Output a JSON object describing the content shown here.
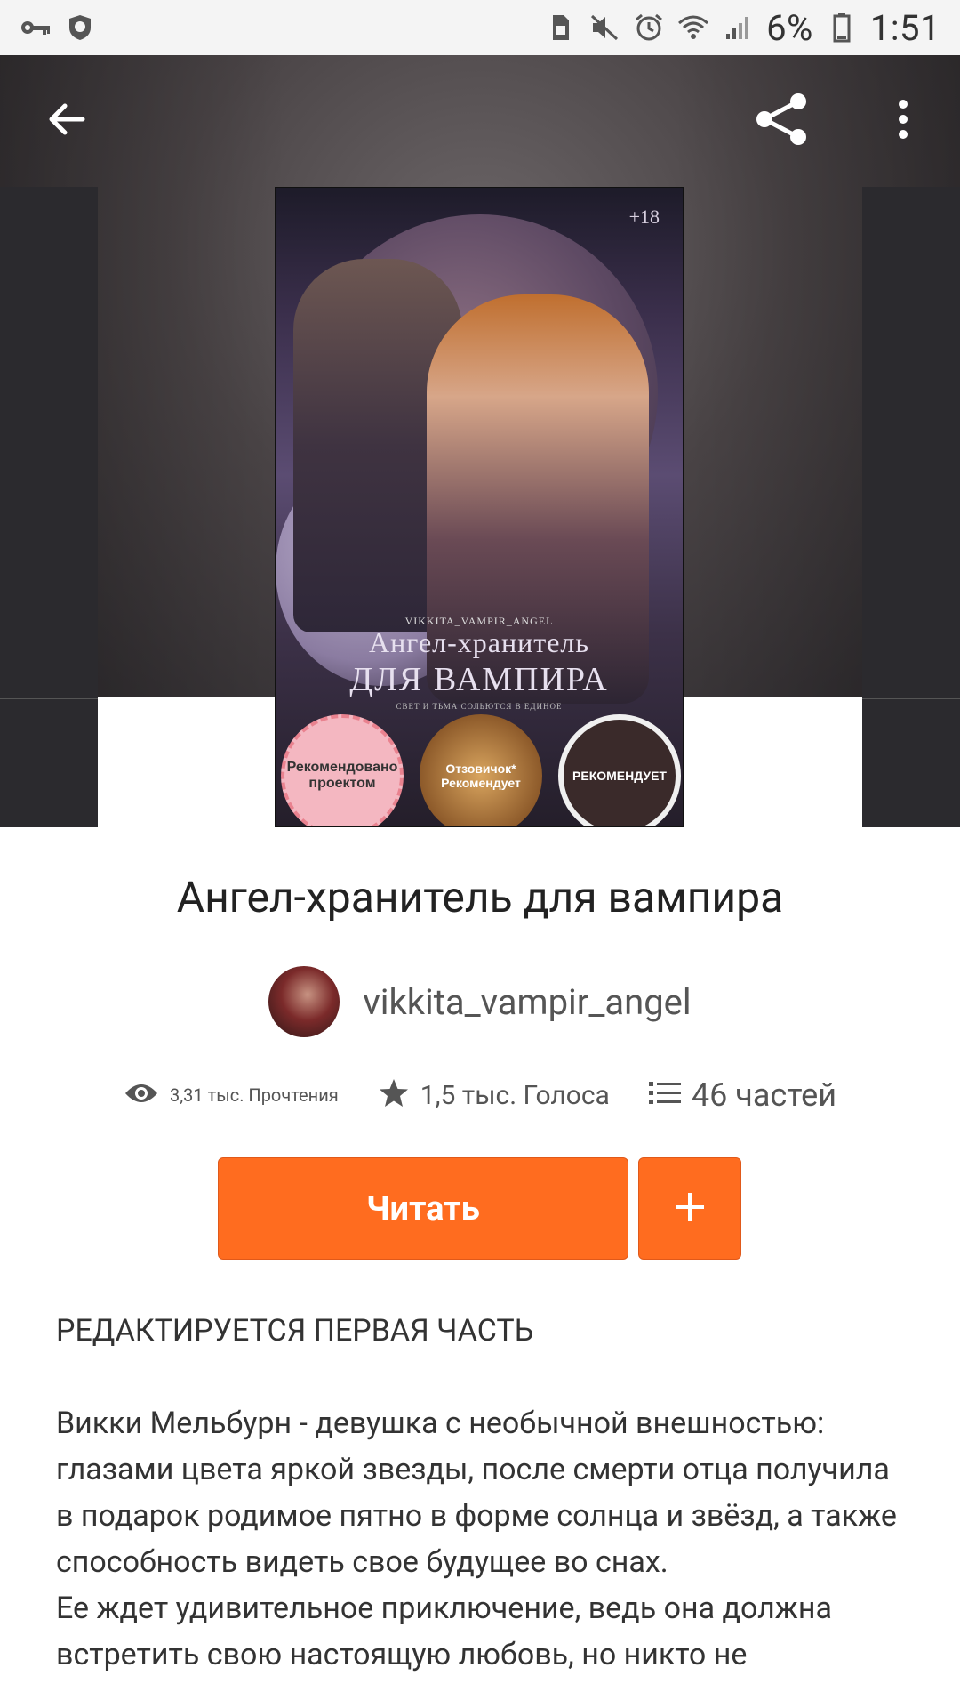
{
  "status_bar": {
    "left_icons": [
      "key-icon",
      "shield-icon"
    ],
    "right_icons": [
      "sim-icon",
      "mute-icon",
      "alarm-icon",
      "wifi-icon",
      "signal-icon",
      "battery-icon"
    ],
    "battery": "6%",
    "time": "1:51"
  },
  "toolbar": {
    "back_icon": "arrow-left-icon",
    "share_icon": "share-icon",
    "more_icon": "more-vertical-icon"
  },
  "cover": {
    "age_rating": "+18",
    "author_small": "VIKKITA_VAMPIR_ANGEL",
    "title_line1": "Ангел-хранитель",
    "title_line2": "ДЛЯ ВАМПИРА",
    "tagline": "СВЕТ И ТЬМА СОЛЬЮТСЯ В ЕДИНОЕ",
    "badge1": "Рекомендовано проектом",
    "badge2": "Отзовичок* Рекомендует",
    "badge3": "РЕКОМЕНДУЕТ"
  },
  "book": {
    "title": "Ангел-хранитель для вампира",
    "author": "vikkita_vampir_angel"
  },
  "stats": {
    "reads": "3,31 тыс. Прочтения",
    "votes": "1,5 тыс. Голоса",
    "parts": "46 частей"
  },
  "actions": {
    "read_label": "Читать"
  },
  "description": {
    "heading": "РЕДАКТИРУЕТСЯ ПЕРВАЯ ЧАСТЬ",
    "para1": "Викки Мельбурн - девушка с необычной внешностью: глазами цвета яркой звезды, после смерти отца получила в подарок родимое пятно в форме солнца и звёзд, а также способность видеть свое будущее во снах.",
    "para2": "Ее ждет удивительное приключение, ведь она должна встретить свою настоящую любовь, но никто не"
  },
  "colors": {
    "accent": "#ff6c1f",
    "hero_bg": "#4a4446"
  }
}
